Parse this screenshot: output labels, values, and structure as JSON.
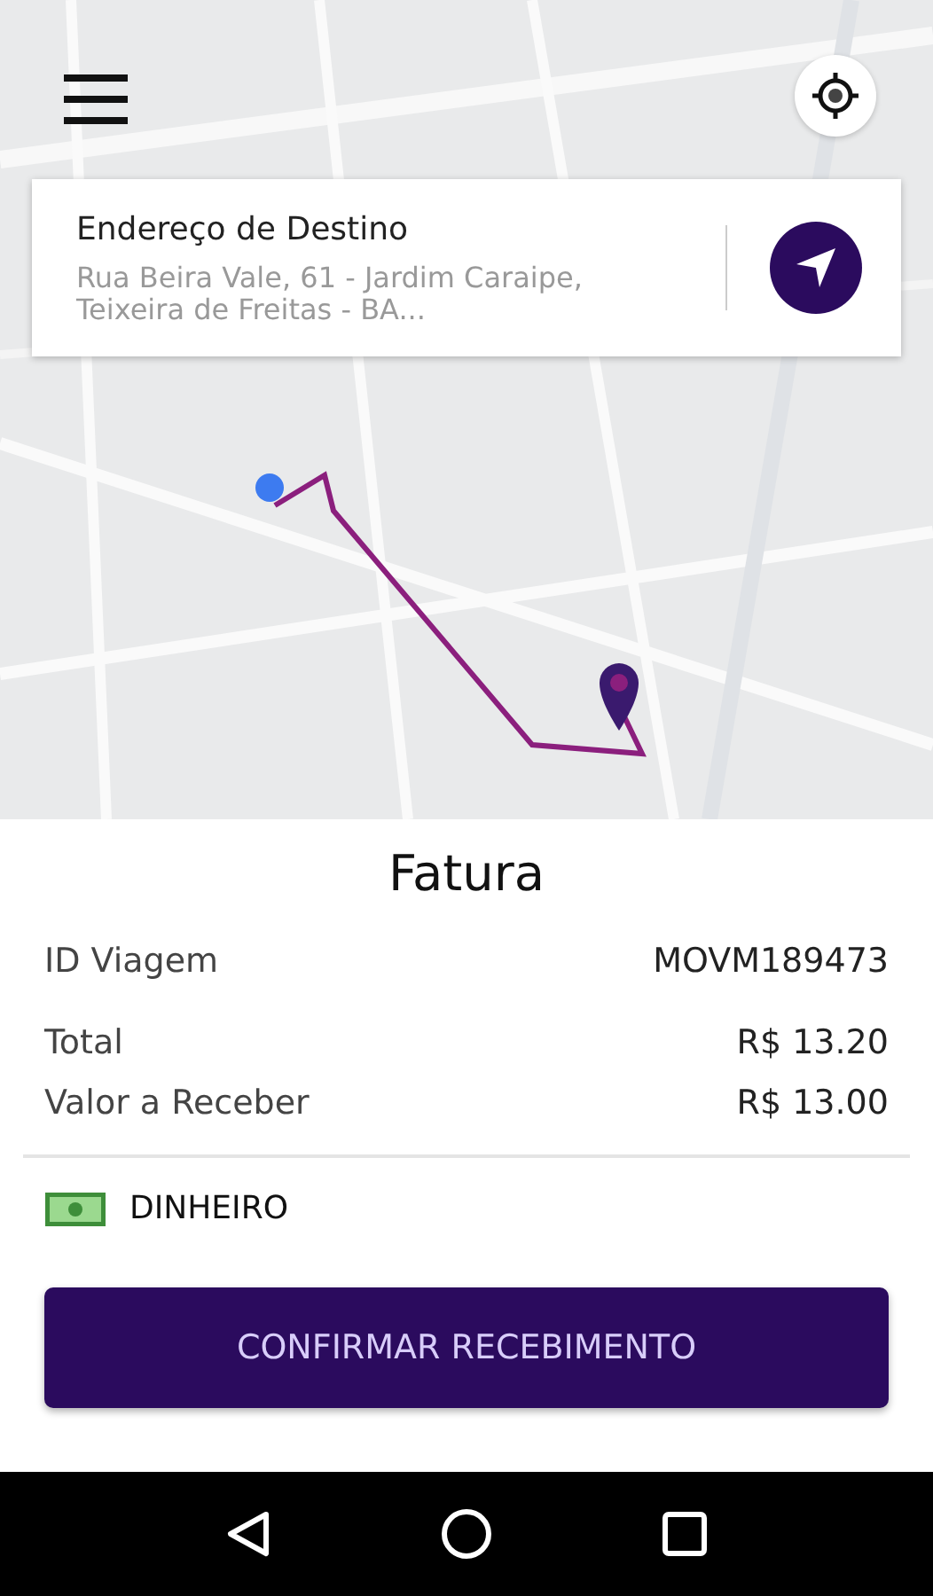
{
  "destination": {
    "title": "Endereço de Destino",
    "address": "Rua Beira Vale, 61 - Jardim Caraipe, Teixeira de Freitas - BA..."
  },
  "invoice": {
    "title": "Fatura",
    "rows": [
      {
        "label": "ID Viagem",
        "value": "MOVM189473"
      },
      {
        "label": "Total",
        "value": "R$ 13.20"
      },
      {
        "label": "Valor a Receber",
        "value": "R$ 13.00"
      }
    ],
    "payment": "DINHEIRO",
    "confirm": "CONFIRMAR RECEBIMENTO"
  }
}
